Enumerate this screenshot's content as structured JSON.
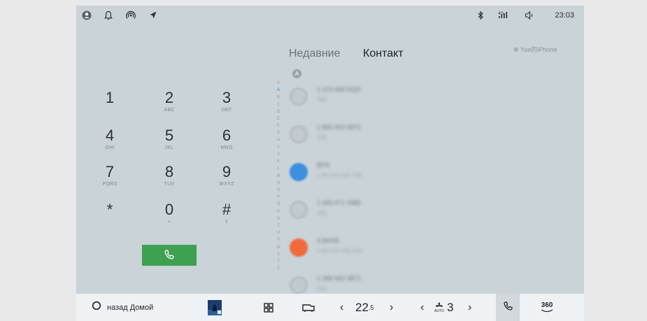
{
  "status_bar": {
    "time": "23:03",
    "network": "4G",
    "icons": [
      "user-icon",
      "bell-icon",
      "wireless-icon",
      "location-arrow-icon",
      "bluetooth-icon",
      "signal-icon",
      "volume-icon"
    ]
  },
  "tabs": [
    {
      "label": "Недавние",
      "active": false
    },
    {
      "label": "Контакт",
      "active": true
    }
  ],
  "device_name": "✻ Yue的iPhone",
  "dialpad": [
    {
      "digit": "1",
      "letters": ""
    },
    {
      "digit": "2",
      "letters": "ABC"
    },
    {
      "digit": "3",
      "letters": "DEF"
    },
    {
      "digit": "4",
      "letters": "GHI"
    },
    {
      "digit": "5",
      "letters": "JKL"
    },
    {
      "digit": "6",
      "letters": "MNO"
    },
    {
      "digit": "7",
      "letters": "PQRS"
    },
    {
      "digit": "8",
      "letters": "TUV"
    },
    {
      "digit": "9",
      "letters": "WXYZ"
    },
    {
      "digit": "*",
      "letters": "·"
    },
    {
      "digit": "0",
      "letters": "+"
    },
    {
      "digit": "#",
      "letters": "‡"
    }
  ],
  "alphabet_index": [
    "#",
    "A",
    "B",
    "C",
    "D",
    "E",
    "F",
    "G",
    "H",
    "I",
    "J",
    "K",
    "L",
    "M",
    "N",
    "O",
    "P",
    "Q",
    "R",
    "S",
    "T",
    "U",
    "V",
    "W",
    "X",
    "Y",
    "Z"
  ],
  "alphabet_active": "A",
  "contact_section_letter": "A",
  "contacts": [
    {
      "name": "1 373 468 5320",
      "sub": "手机",
      "avatar": "gray"
    },
    {
      "name": "1 863 463 3872",
      "sub": "手机",
      "avatar": "gray"
    },
    {
      "name": "BFN",
      "sub": "1 860 000 0000 手机",
      "avatar": "blue"
    },
    {
      "name": "1 305 471 3385",
      "sub": "手机",
      "avatar": "gray"
    },
    {
      "name": "A.BASE",
      "sub": "1 860 000 0000 手机",
      "avatar": "orange"
    },
    {
      "name": "1 368 463 3872",
      "sub": "手机",
      "avatar": "gray"
    }
  ],
  "bottom_bar": {
    "home_label": "назад Домой",
    "temperature": "22",
    "temperature_decimal": ".5",
    "fan_level": "3",
    "fan_auto_label": "AUTO",
    "camera_label": "360"
  },
  "colors": {
    "call_button": "#3ea14f",
    "active_index": "#2f7fd3",
    "screen_background": "#c9d3d8"
  }
}
